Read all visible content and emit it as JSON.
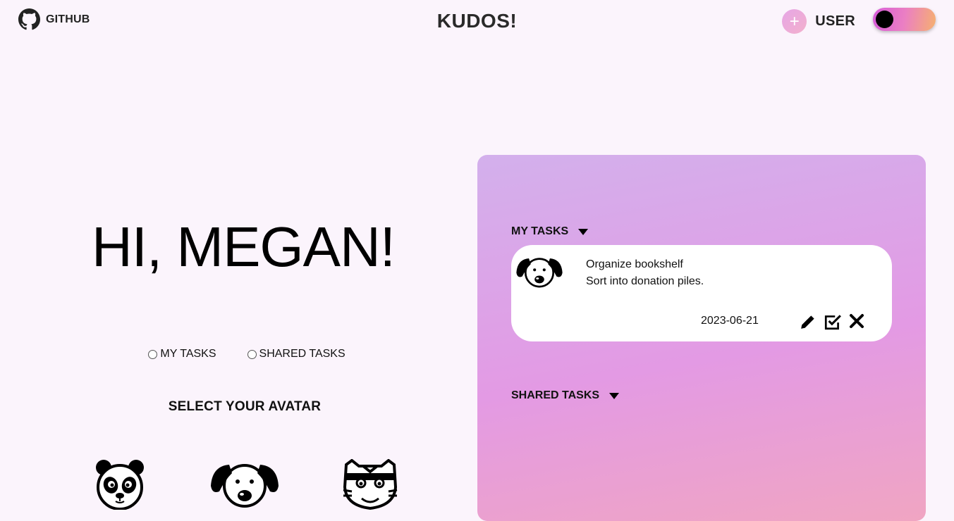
{
  "header": {
    "github_label": "GITHUB",
    "app_title": "KUDOS!",
    "add_symbol": "+",
    "user_label": "USER"
  },
  "main": {
    "greeting": "HI, MEGAN!",
    "radio_options": [
      {
        "label": "MY TASKS",
        "checked": false
      },
      {
        "label": "SHARED TASKS",
        "checked": false
      }
    ],
    "avatar_heading": "SELECT YOUR AVATAR",
    "avatars": [
      "panda-icon",
      "dog-icon",
      "tiger-icon"
    ]
  },
  "panel": {
    "my_tasks_title": "MY TASKS",
    "shared_tasks_title": "SHARED TASKS",
    "tasks": [
      {
        "avatar": "dog-icon",
        "title": "Organize bookshelf",
        "description": "Sort into donation piles.",
        "date": "2023-06-21",
        "actions": [
          "pencil-icon",
          "checkbox-icon",
          "close-icon"
        ]
      }
    ]
  },
  "colors": {
    "background": "#fbf4fc",
    "panel_gradient_top": "#d3b0ec",
    "panel_gradient_mid": "#e39ae4",
    "panel_gradient_bottom": "#f0a5c2",
    "toggle_gradient": [
      "#d65ad9",
      "#eb7fc3",
      "#f6b06f"
    ]
  }
}
